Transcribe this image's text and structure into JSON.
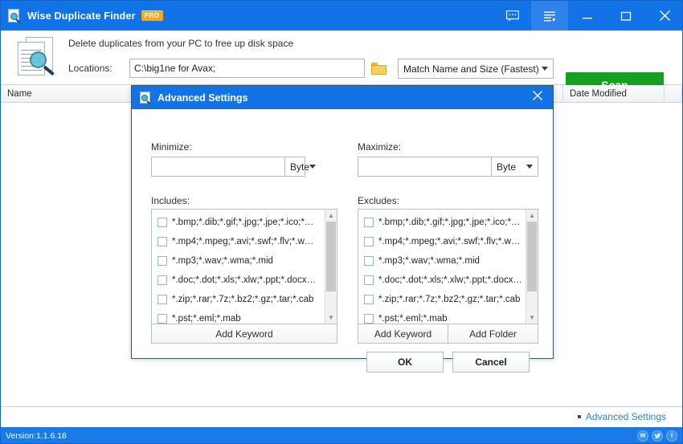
{
  "titlebar": {
    "app_name": "Wise Duplicate Finder",
    "pro_badge": "PRO",
    "app_icon": "document-magnifier-icon",
    "buttons": {
      "feedback": "feedback-icon",
      "menu": "menu-icon",
      "minimize": "minimize-icon",
      "maximize": "maximize-icon",
      "close": "close-icon"
    },
    "bg_color": "#1273E6"
  },
  "header": {
    "tagline": "Delete duplicates from your PC to free up disk space",
    "locations_label": "Locations:",
    "locations_value": "C:\\big1ne for Avax;",
    "locations_placeholder": "",
    "browse_icon": "folder-icon",
    "match_mode": "Match Name and Size (Fastest)",
    "scan_label": "Scan",
    "scan_color": "#15A021"
  },
  "columns": {
    "name": "Name",
    "date_modified": "Date Modified"
  },
  "footer": {
    "advanced_settings_link": "Advanced Settings",
    "version": "Version:1.1.6.18",
    "social": [
      {
        "name": "email-icon",
        "glyph": "✉"
      },
      {
        "name": "twitter-icon",
        "glyph": "ᵛ"
      },
      {
        "name": "facebook-icon",
        "glyph": "f"
      }
    ],
    "bar_color": "#1A7AE8"
  },
  "dialog": {
    "title": "Advanced Settings",
    "icon": "document-magnifier-icon",
    "close_icon": "close-icon",
    "minimize_label": "Minimize:",
    "minimize_value": "",
    "minimize_unit": "Byte",
    "maximize_label": "Maximize:",
    "maximize_value": "",
    "maximize_unit": "Byte",
    "includes_label": "Includes:",
    "excludes_label": "Excludes:",
    "filters": [
      "*.bmp;*.dib;*.gif;*.jpg;*.jpe;*.ico;*…",
      "*.mp4;*.mpeg;*.avi;*.swf;*.flv;*.w…",
      "*.mp3;*.wav;*.wma;*.mid",
      "*.doc;*.dot;*.xls;*.xlw;*.ppt;*.docx…",
      "*.zip;*.rar;*.7z;*.bz2;*.gz;*.tar;*.cab",
      "*.pst;*.eml;*.mab"
    ],
    "includes_add_keyword": "Add Keyword",
    "excludes_add_keyword": "Add Keyword",
    "excludes_add_folder": "Add Folder",
    "ok_label": "OK",
    "cancel_label": "Cancel"
  }
}
